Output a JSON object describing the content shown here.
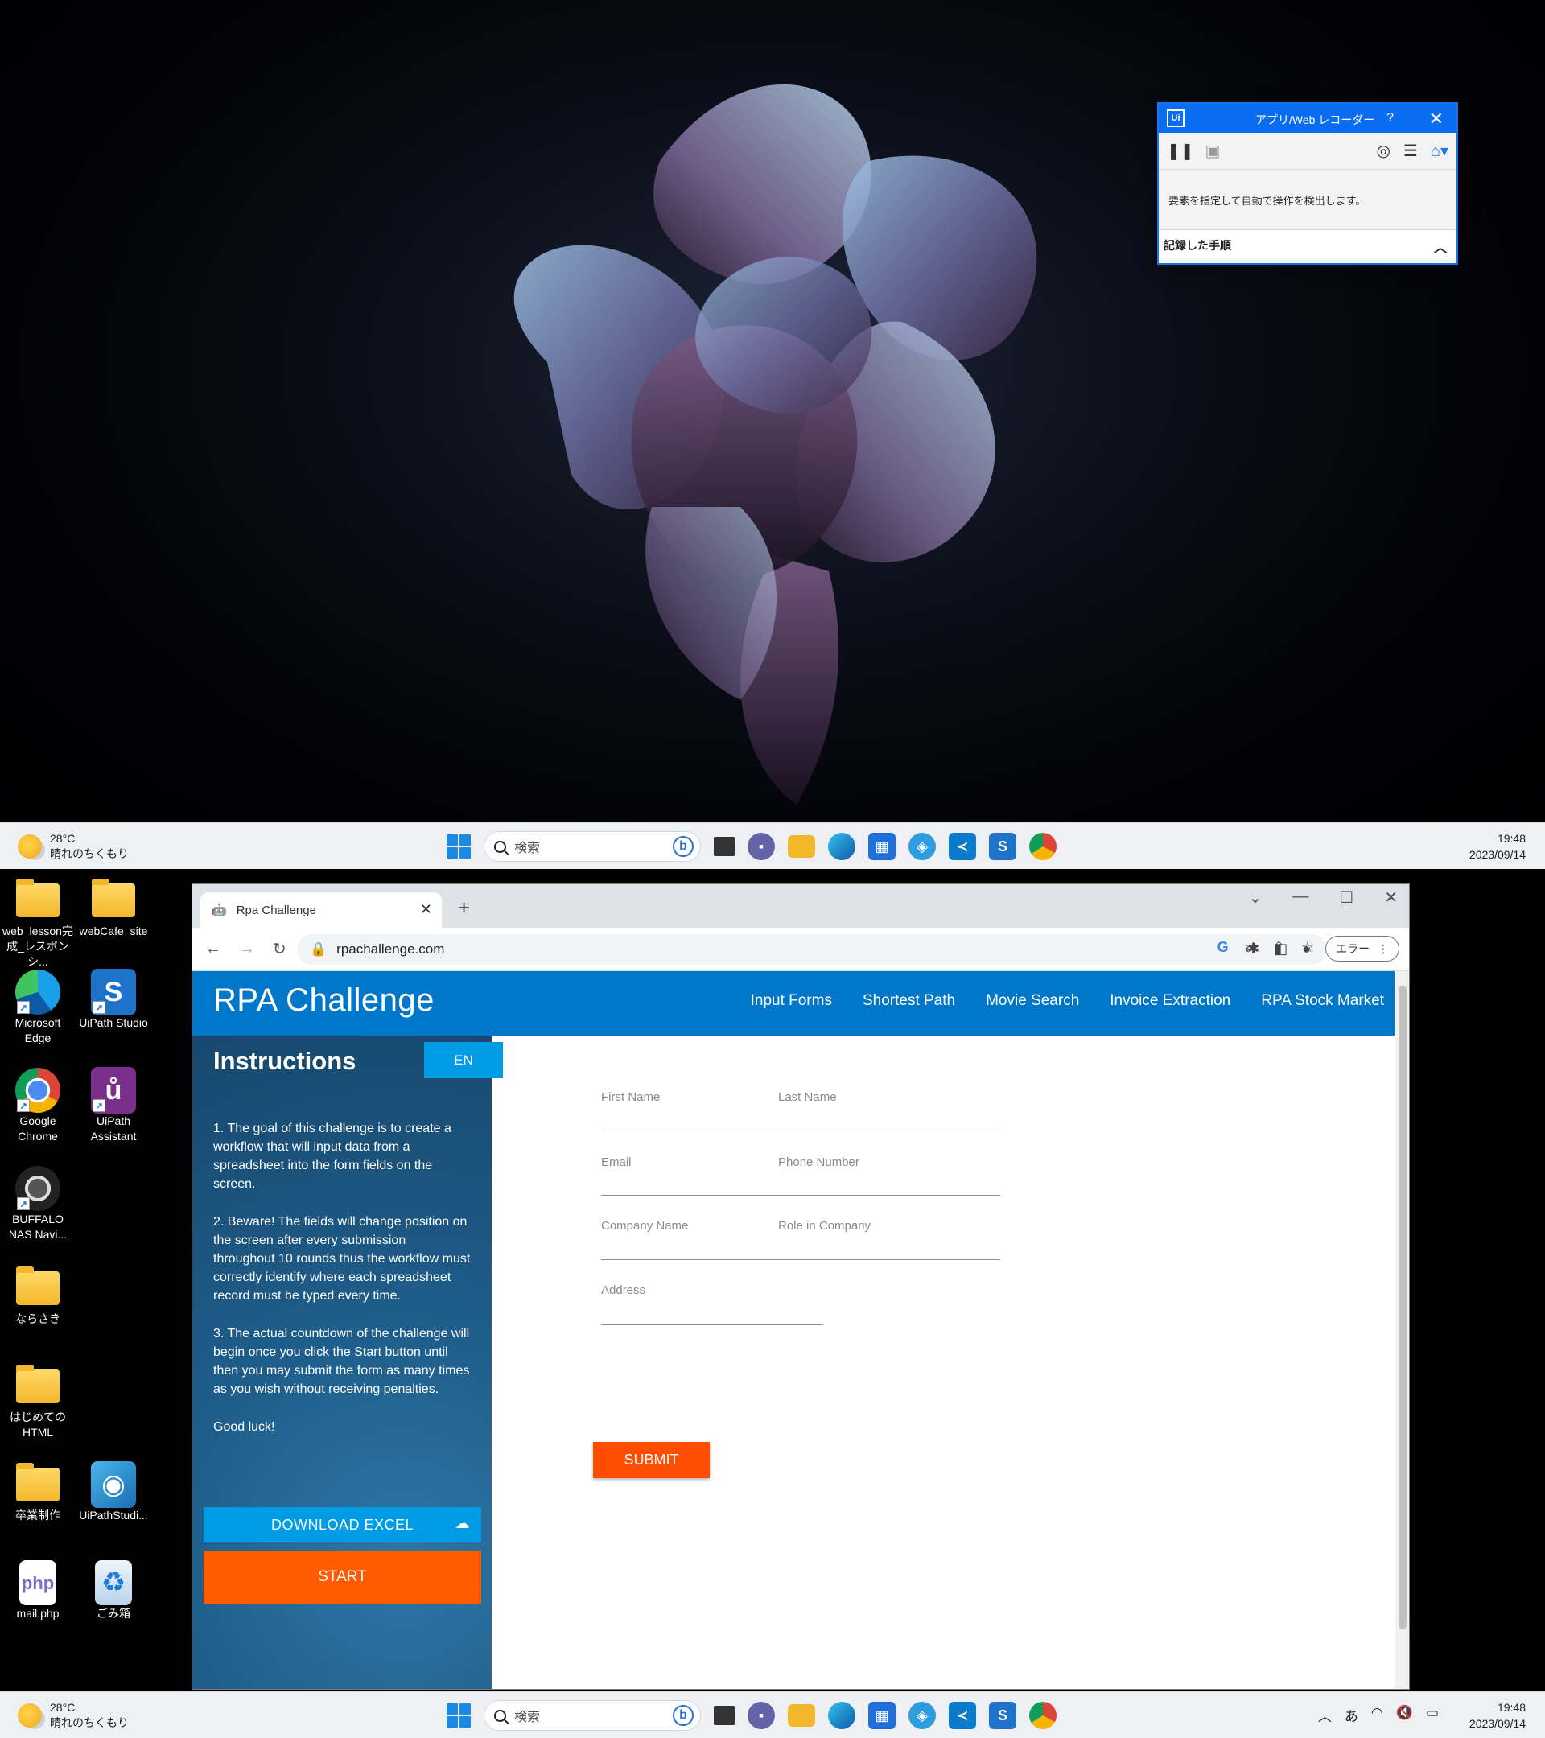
{
  "desktop_top": {
    "recorder": {
      "title": "アプリ/Web レコーダー",
      "help": "?",
      "message": "要素を指定して自動で操作を検出します。",
      "steps_label": "記録した手順"
    }
  },
  "taskbar": {
    "temperature": "28°C",
    "weather": "晴れのちくもり",
    "search_placeholder": "検索",
    "time": "19:48",
    "date": "2023/09/14",
    "ime": "あ"
  },
  "desktop_icons": [
    {
      "label": "web_lesson完成_レスポンシ..."
    },
    {
      "label": "webCafe_site"
    },
    {
      "label": "Microsoft Edge"
    },
    {
      "label": "UiPath Studio"
    },
    {
      "label": "Google Chrome"
    },
    {
      "label": "UiPath Assistant"
    },
    {
      "label": "BUFFALO NAS Navi..."
    },
    {
      "label": "ならさき"
    },
    {
      "label": "はじめてのHTML"
    },
    {
      "label": "卒業制作"
    },
    {
      "label": "UiPathStudi..."
    },
    {
      "label": "mail.php"
    },
    {
      "label": "ごみ箱"
    }
  ],
  "browser": {
    "tab_title": "Rpa Challenge",
    "url": "rpachallenge.com",
    "profile_status": "エラー"
  },
  "rpa": {
    "brand": "RPA Challenge",
    "nav": [
      "Input Forms",
      "Shortest Path",
      "Movie Search",
      "Invoice Extraction",
      "RPA Stock Market"
    ],
    "instructions_title": "Instructions",
    "lang": "EN",
    "instructions": [
      "1. The goal of this challenge is to create a workflow that will input data from a spreadsheet into the form fields on the screen.",
      "2. Beware! The fields will change position on the screen after every submission throughout 10 rounds thus the workflow must correctly identify where each spreadsheet record must be typed every time.",
      "3. The actual countdown of the challenge will begin once you click the Start button until then you may submit the form as many times as you wish without receiving penalties.",
      "Good luck!"
    ],
    "download_label": "DOWNLOAD EXCEL",
    "start_label": "START",
    "form": {
      "first_name": "First Name",
      "last_name": "Last Name",
      "email": "Email",
      "phone": "Phone Number",
      "company": "Company Name",
      "role": "Role in Company",
      "address": "Address",
      "submit": "SUBMIT"
    }
  }
}
